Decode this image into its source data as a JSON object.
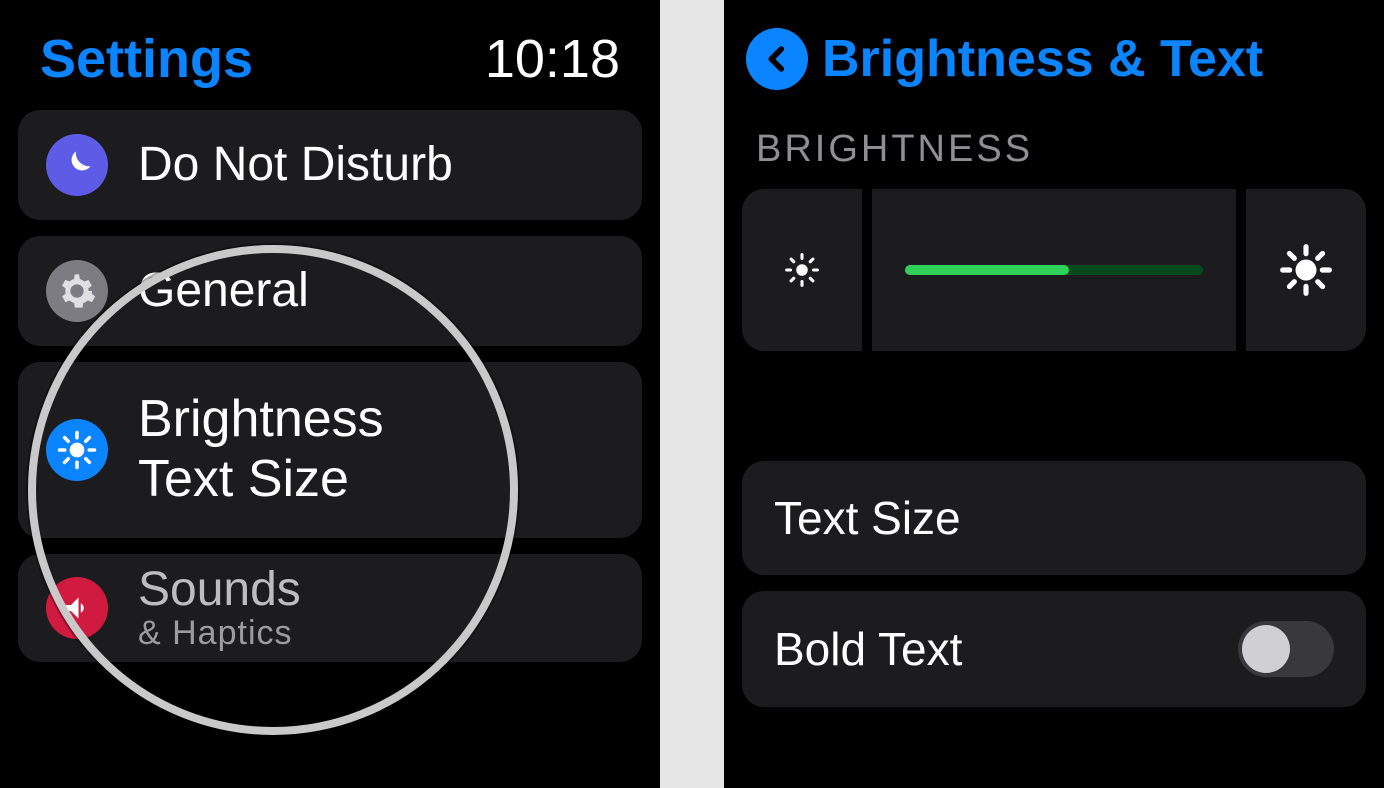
{
  "left": {
    "title": "Settings",
    "time": "10:18",
    "rows": {
      "dnd": {
        "label": "Do Not Disturb",
        "icon": "moon-icon"
      },
      "general": {
        "label": "General",
        "icon": "gear-icon"
      },
      "bright": {
        "label1": "Brightness",
        "label2": "Text Size",
        "icon": "sun-icon"
      },
      "sounds": {
        "label": "Sounds",
        "sub": "& Haptics",
        "icon": "speaker-icon"
      }
    }
  },
  "right": {
    "title": "Brightness & Text",
    "section_label": "BRIGHTNESS",
    "brightness_percent": 55,
    "text_size_label": "Text Size",
    "bold_text_label": "Bold Text",
    "bold_text_on": false
  },
  "colors": {
    "accent": "#0a84ff",
    "green": "#30d158",
    "dnd_purple": "#5e5ce6",
    "sound_red": "#d11a3f",
    "gear_grey": "#7c7c82"
  }
}
